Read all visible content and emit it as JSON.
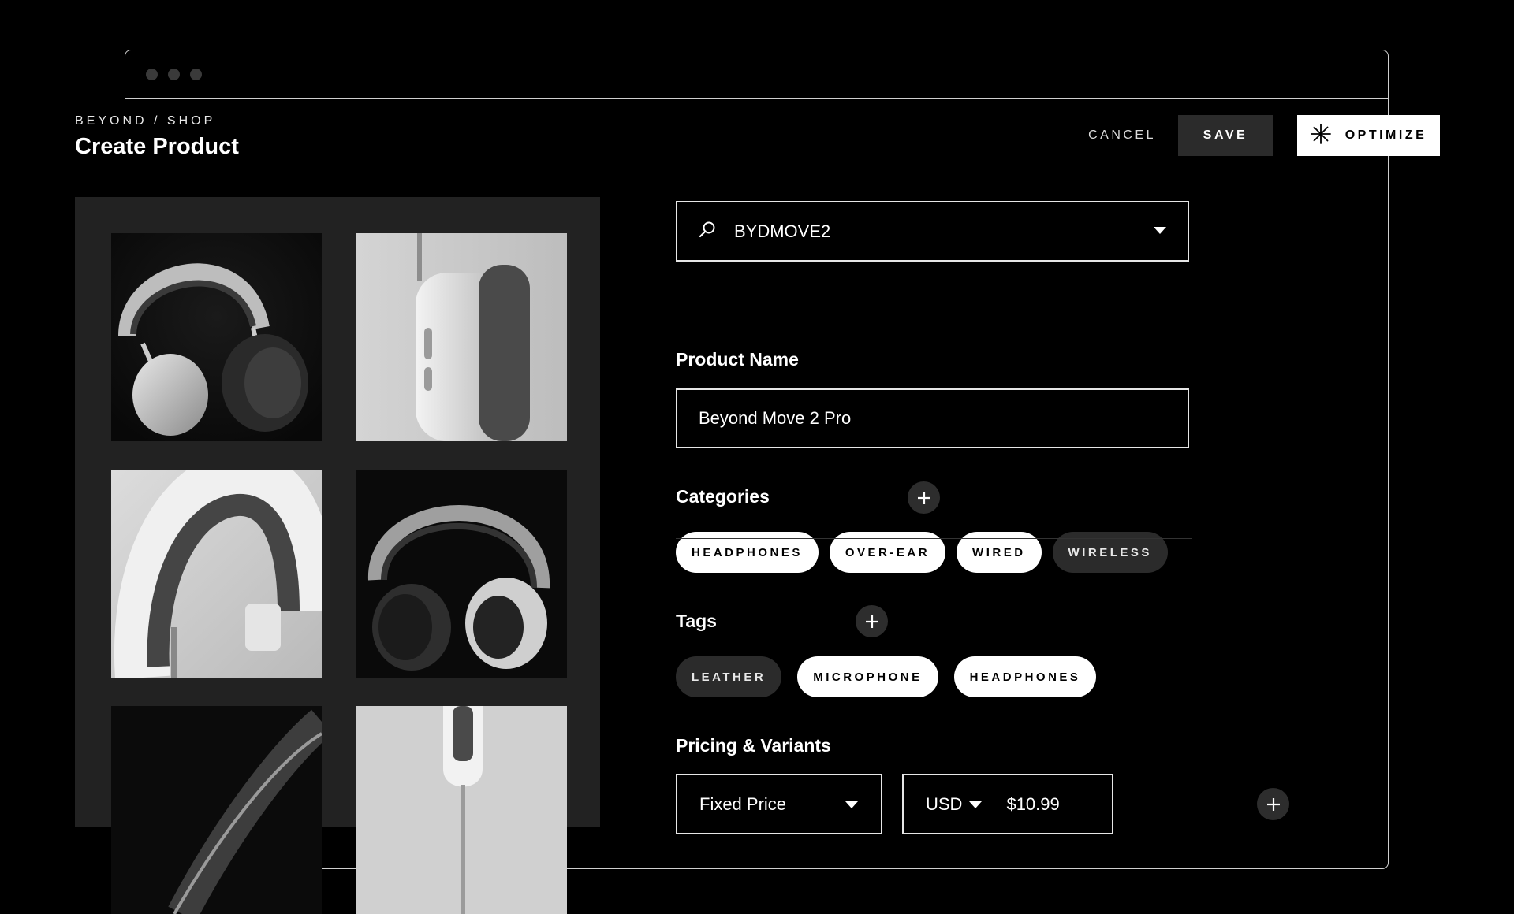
{
  "header": {
    "breadcrumb": "BEYOND / SHOP",
    "title": "Create Product"
  },
  "actions": {
    "cancel_label": "CANCEL",
    "save_label": "SAVE",
    "optimize_label": "OPTIMIZE"
  },
  "search": {
    "value": "BYDMOVE2",
    "icon": "search-icon"
  },
  "product_name": {
    "label": "Product Name",
    "value": "Beyond Move 2 Pro"
  },
  "categories": {
    "label": "Categories",
    "items": [
      {
        "label": "HEADPHONES",
        "selected": true
      },
      {
        "label": "OVER-EAR",
        "selected": true
      },
      {
        "label": "WIRED",
        "selected": true
      },
      {
        "label": "WIRELESS",
        "selected": false
      }
    ]
  },
  "tags": {
    "label": "Tags",
    "items": [
      {
        "label": "LEATHER",
        "selected": false
      },
      {
        "label": "MICROPHONE",
        "selected": true
      },
      {
        "label": "HEADPHONES",
        "selected": true
      }
    ]
  },
  "pricing": {
    "label": "Pricing & Variants",
    "price_type": "Fixed Price",
    "currency": "USD",
    "amount": "$10.99"
  },
  "colors": {
    "accent": "#ffffff",
    "surface": "#222222",
    "chip_dark": "#2b2b2b"
  }
}
